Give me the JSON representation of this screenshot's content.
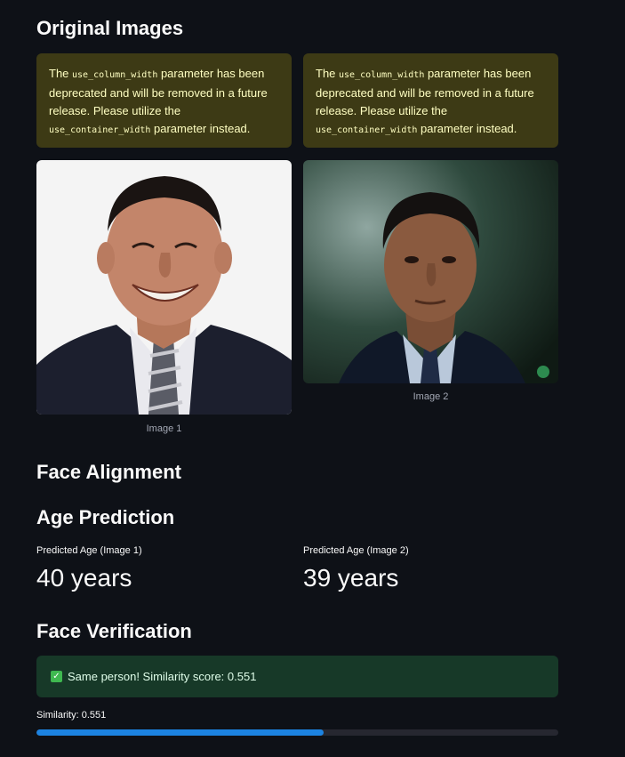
{
  "sections": {
    "original_images": "Original Images",
    "face_alignment": "Face Alignment",
    "age_prediction": "Age Prediction",
    "face_verification": "Face Verification"
  },
  "warning": {
    "before": "The ",
    "code1": "use_column_width",
    "middle": " parameter has been deprecated and will be removed in a future release. Please utilize the ",
    "code2": "use_container_width",
    "after": " parameter instead."
  },
  "images": [
    {
      "caption": "Image 1"
    },
    {
      "caption": "Image 2"
    }
  ],
  "ages": [
    {
      "label": "Predicted Age (Image 1)",
      "value": "40 years"
    },
    {
      "label": "Predicted Age (Image 2)",
      "value": "39 years"
    }
  ],
  "verification": {
    "message": "Same person! Similarity score: 0.551",
    "similarity_label": "Similarity: 0.551",
    "similarity_value": 0.551
  },
  "colors": {
    "progress": "#1c83e1",
    "success_bg": "#173928",
    "warning_bg": "#3d3a15"
  }
}
